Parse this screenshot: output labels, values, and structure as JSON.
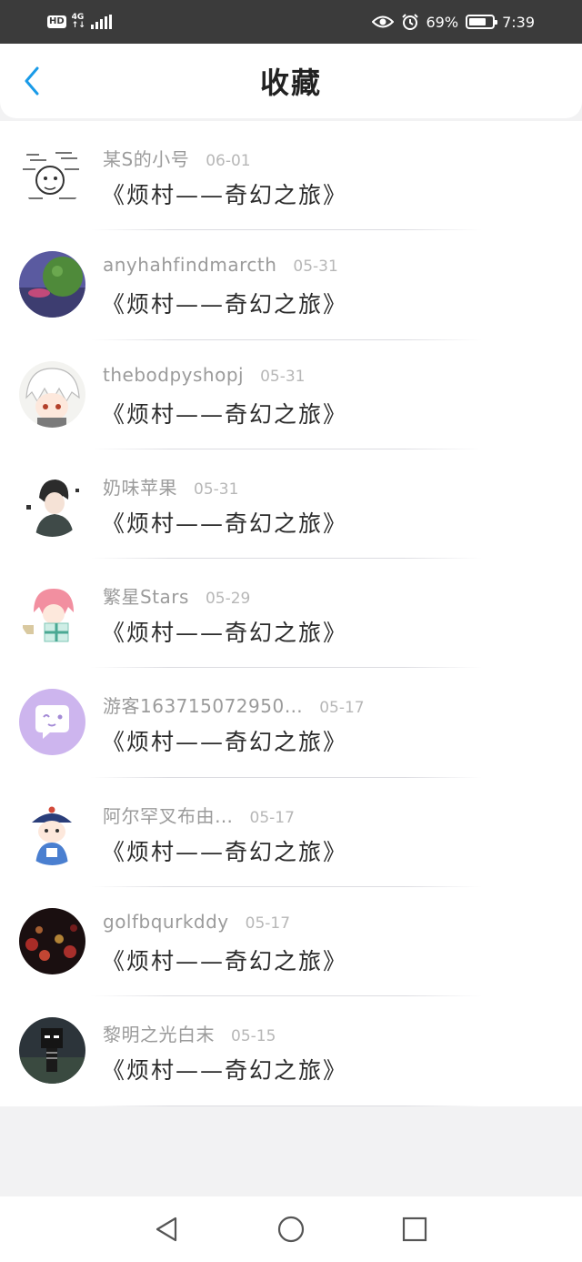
{
  "status_bar": {
    "hd": "HD",
    "net_top": "4G",
    "net_bottom": "↑↓",
    "battery": "69%",
    "time": "7:39"
  },
  "header": {
    "title": "收藏",
    "back_icon": "chevron-left-icon",
    "accent": "#1a9be8"
  },
  "items": [
    {
      "user": "某S的小号",
      "date": "06-01",
      "title": "《烦村——奇幻之旅》",
      "avatar": "meme-drawing"
    },
    {
      "user": "anyhahfindmarcth",
      "date": "05-31",
      "title": "《烦村——奇幻之旅》",
      "avatar": "green-planet"
    },
    {
      "user": "thebodpyshopj",
      "date": "05-31",
      "title": "《烦村——奇幻之旅》",
      "avatar": "white-hair-anime"
    },
    {
      "user": "奶味苹果",
      "date": "05-31",
      "title": "《烦村——奇幻之旅》",
      "avatar": "dark-hair-anime"
    },
    {
      "user": "繁星Stars",
      "date": "05-29",
      "title": "《烦村——奇幻之旅》",
      "avatar": "pink-hair-anime"
    },
    {
      "user": "游客163715072950…",
      "date": "05-17",
      "title": "《烦村——奇幻之旅》",
      "avatar": "purple-chat-bubble"
    },
    {
      "user": "阿尔罕叉布由…",
      "date": "05-17",
      "title": "《烦村——奇幻之旅》",
      "avatar": "qing-official-cartoon"
    },
    {
      "user": "golfbqurkddy",
      "date": "05-17",
      "title": "《烦村——奇幻之旅》",
      "avatar": "bokeh-hearts"
    },
    {
      "user": "黎明之光白末",
      "date": "05-15",
      "title": "《烦村——奇幻之旅》",
      "avatar": "pixel-skeleton"
    }
  ],
  "nav": {
    "back": "triangle-back-icon",
    "home": "circle-home-icon",
    "recents": "square-recents-icon"
  }
}
